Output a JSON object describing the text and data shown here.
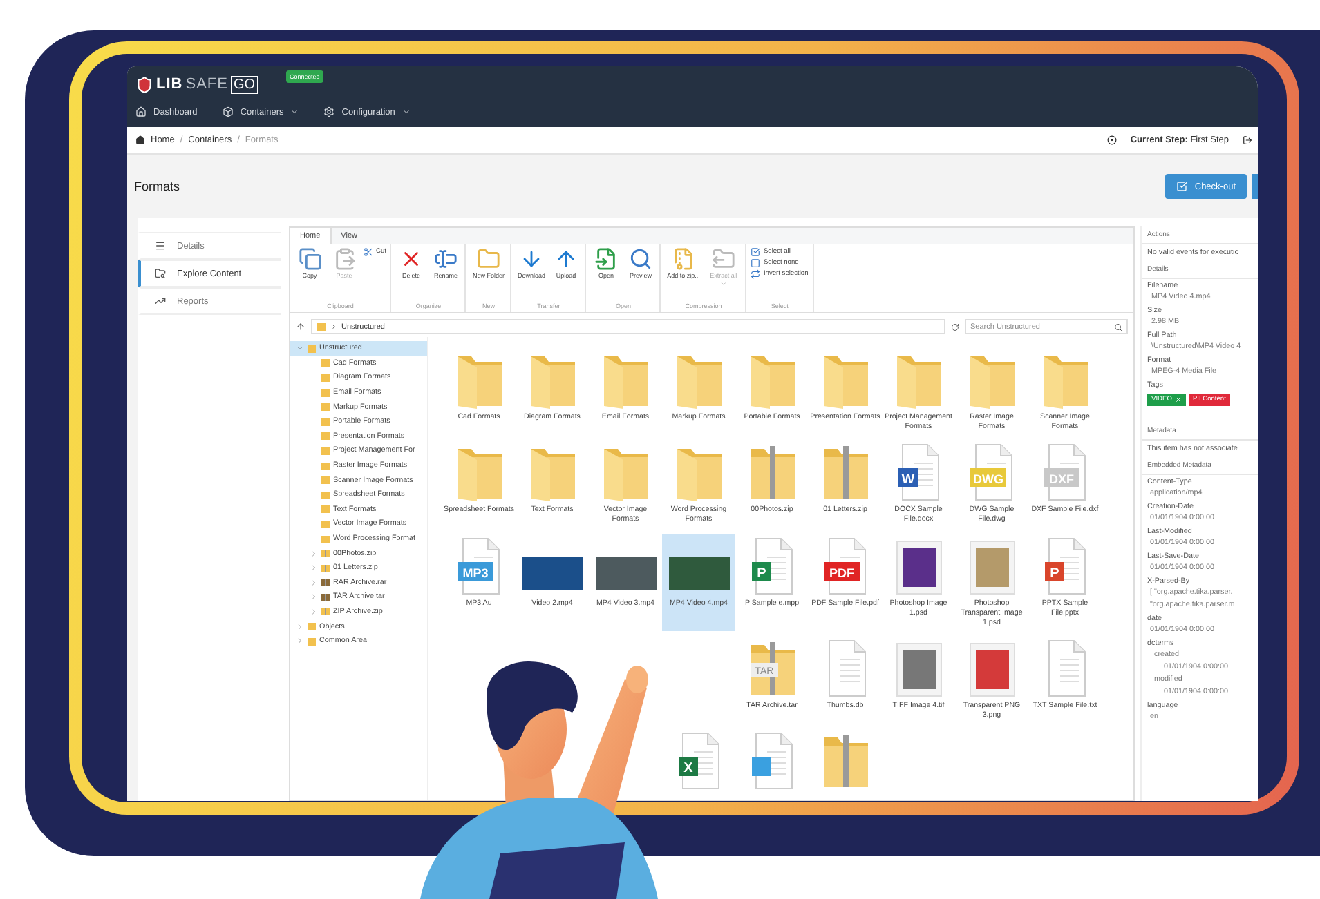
{
  "app": {
    "logo_left": "LIB",
    "logo_right": "SAFE",
    "logo_badge": "GO",
    "status": "Connected"
  },
  "nav": [
    {
      "label": "Dashboard",
      "dropdown": false
    },
    {
      "label": "Containers",
      "dropdown": true
    },
    {
      "label": "Configuration",
      "dropdown": true
    }
  ],
  "breadcrumb": [
    "Home",
    "Containers",
    "Formats"
  ],
  "breadcrumb_separator": "/",
  "current_step": {
    "label": "Current Step:",
    "value": "First Step"
  },
  "page_title": "Formats",
  "checkout_button": "Check-out",
  "side_menu": [
    {
      "label": "Details",
      "selected": false
    },
    {
      "label": "Explore Content",
      "selected": true
    },
    {
      "label": "Reports",
      "selected": false
    }
  ],
  "explorer": {
    "tabs": [
      {
        "label": "Home",
        "selected": true
      },
      {
        "label": "View",
        "selected": false
      }
    ],
    "ribbon_groups": [
      {
        "name": "Clipboard",
        "buttons": [
          {
            "label": "Copy",
            "kind": "large",
            "disabled": false
          },
          {
            "label": "Paste",
            "kind": "large",
            "disabled": true
          },
          {
            "label": "Cut",
            "kind": "small",
            "disabled": false
          }
        ]
      },
      {
        "name": "Organize",
        "buttons": [
          {
            "label": "Delete",
            "kind": "large",
            "disabled": false
          },
          {
            "label": "Rename",
            "kind": "large",
            "disabled": false
          }
        ]
      },
      {
        "name": "New",
        "buttons": [
          {
            "label": "New Folder",
            "kind": "large",
            "disabled": false
          }
        ]
      },
      {
        "name": "Transfer",
        "buttons": [
          {
            "label": "Download",
            "kind": "large",
            "disabled": false
          },
          {
            "label": "Upload",
            "kind": "large",
            "disabled": false
          }
        ]
      },
      {
        "name": "Open",
        "buttons": [
          {
            "label": "Open",
            "kind": "large",
            "disabled": false
          },
          {
            "label": "Preview",
            "kind": "large",
            "disabled": false
          }
        ]
      },
      {
        "name": "Compression",
        "buttons": [
          {
            "label": "Add to zip...",
            "kind": "large",
            "disabled": false
          },
          {
            "label": "Extract all",
            "kind": "large",
            "disabled": true,
            "dropdown": true
          }
        ]
      },
      {
        "name": "Select",
        "buttons": [
          {
            "label": "Select all",
            "kind": "small",
            "disabled": false
          },
          {
            "label": "Select none",
            "kind": "small",
            "disabled": false
          },
          {
            "label": "Invert selection",
            "kind": "small",
            "disabled": false
          }
        ]
      }
    ],
    "path": "Unstructured",
    "search_placeholder": "Search Unstructured",
    "tree": [
      {
        "label": "Unstructured",
        "kind": "folder",
        "expanded": true,
        "selected": true,
        "children": [
          {
            "label": "Cad Formats",
            "kind": "folder",
            "selected": false
          },
          {
            "label": "Diagram Formats",
            "kind": "folder",
            "selected": false
          },
          {
            "label": "Email Formats",
            "kind": "folder",
            "selected": false
          },
          {
            "label": "Markup Formats",
            "kind": "folder",
            "selected": false
          },
          {
            "label": "Portable Formats",
            "kind": "folder",
            "selected": false
          },
          {
            "label": "Presentation Formats",
            "kind": "folder",
            "selected": false
          },
          {
            "label": "Project Management For",
            "kind": "folder",
            "selected": false
          },
          {
            "label": "Raster Image Formats",
            "kind": "folder",
            "selected": false
          },
          {
            "label": "Scanner Image Formats",
            "kind": "folder",
            "selected": false
          },
          {
            "label": "Spreadsheet Formats",
            "kind": "folder",
            "selected": false
          },
          {
            "label": "Text Formats",
            "kind": "folder",
            "selected": false
          },
          {
            "label": "Vector Image Formats",
            "kind": "folder",
            "selected": false
          },
          {
            "label": "Word Processing Format",
            "kind": "folder",
            "selected": false
          },
          {
            "label": "00Photos.zip",
            "kind": "zip",
            "expanded": false,
            "selected": false
          },
          {
            "label": "01 Letters.zip",
            "kind": "zip",
            "expanded": false,
            "selected": false
          },
          {
            "label": "RAR Archive.rar",
            "kind": "archive",
            "expanded": false,
            "selected": false
          },
          {
            "label": "TAR Archive.tar",
            "kind": "archive",
            "expanded": false,
            "selected": false
          },
          {
            "label": "ZIP Archive.zip",
            "kind": "zip",
            "expanded": false,
            "selected": false
          }
        ]
      },
      {
        "label": "Objects",
        "kind": "folder",
        "expanded": false,
        "selected": false
      },
      {
        "label": "Common Area",
        "kind": "folder",
        "expanded": false,
        "selected": false
      }
    ],
    "items": [
      {
        "label": "Cad Formats",
        "kind": "folder",
        "selected": false
      },
      {
        "label": "Diagram Formats",
        "kind": "folder",
        "selected": false
      },
      {
        "label": "Email Formats",
        "kind": "folder",
        "selected": false
      },
      {
        "label": "Markup Formats",
        "kind": "folder",
        "selected": false
      },
      {
        "label": "Portable Formats",
        "kind": "folder",
        "selected": false
      },
      {
        "label": "Presentation Formats",
        "kind": "folder",
        "selected": false
      },
      {
        "label": "Project Management Formats",
        "kind": "folder",
        "selected": false
      },
      {
        "label": "Raster Image Formats",
        "kind": "folder",
        "selected": false
      },
      {
        "label": "Scanner Image Formats",
        "kind": "folder",
        "selected": false
      },
      {
        "label": "Spreadsheet Formats",
        "kind": "folder",
        "selected": false
      },
      {
        "label": "Text Formats",
        "kind": "folder",
        "selected": false
      },
      {
        "label": "Vector Image Formats",
        "kind": "folder",
        "selected": false
      },
      {
        "label": "Word Processing Formats",
        "kind": "folder",
        "selected": false
      },
      {
        "label": "00Photos.zip",
        "kind": "zip",
        "selected": false
      },
      {
        "label": "01 Letters.zip",
        "kind": "zip",
        "selected": false
      },
      {
        "label": "DOCX Sample File.docx",
        "kind": "document",
        "badge": "W",
        "color": "#2b5fb4",
        "selected": false
      },
      {
        "label": "DWG Sample File.dwg",
        "kind": "document",
        "badge": "DWG",
        "color": "#e8c93a",
        "selected": false
      },
      {
        "label": "DXF Sample File.dxf",
        "kind": "document",
        "badge": "DXF",
        "color": "#c8c8c8",
        "selected": false
      },
      {
        "label": "MP3 Au",
        "kind": "document",
        "badge": "MP3",
        "color": "#3a9ad9",
        "selected": false
      },
      {
        "label": "Video 2.mp4",
        "kind": "video",
        "color": "#1b4f8a",
        "selected": false
      },
      {
        "label": "MP4 Video 3.mp4",
        "kind": "video",
        "color": "#4d5a5e",
        "selected": false
      },
      {
        "label": "MP4 Video 4.mp4",
        "kind": "video",
        "color": "#2f5a3d",
        "selected": true
      },
      {
        "label": "P Sample e.mpp",
        "kind": "document",
        "badge": "P",
        "color": "#1d8a4c",
        "selected": false
      },
      {
        "label": "PDF Sample File.pdf",
        "kind": "document",
        "badge": "PDF",
        "color": "#e02424",
        "selected": false
      },
      {
        "label": "Photoshop Image 1.psd",
        "kind": "image",
        "color": "#5a2f8a",
        "selected": false
      },
      {
        "label": "Photoshop Transparent Image 1.psd",
        "kind": "image",
        "color": "#b49a6a",
        "selected": false
      },
      {
        "label": "PPTX Sample File.pptx",
        "kind": "document",
        "badge": "P",
        "color": "#d9452b",
        "selected": false
      },
      {
        "label": "TAR Archive.tar",
        "kind": "zip",
        "badge": "TAR",
        "selected": false
      },
      {
        "label": "Thumbs.db",
        "kind": "document",
        "selected": false
      },
      {
        "label": "TIFF Image 4.tif",
        "kind": "image",
        "color": "#777777",
        "selected": false
      },
      {
        "label": "Transparent PNG 3.png",
        "kind": "image",
        "color": "#d43a3a",
        "selected": false
      },
      {
        "label": "TXT Sample File.txt",
        "kind": "document",
        "selected": false
      },
      {
        "kind": "document",
        "badge": "X",
        "color": "#1d7a44",
        "selected": false
      },
      {
        "kind": "document",
        "color": "#3aa0e0",
        "selected": false
      },
      {
        "kind": "zip",
        "selected": false
      }
    ]
  },
  "details_panel": {
    "actions_title": "Actions",
    "actions_text": "No valid events for executio",
    "details_title": "Details",
    "fields": [
      {
        "label": "Filename",
        "value": "MP4 Video 4.mp4"
      },
      {
        "label": "Size",
        "value": "2.98 MB"
      },
      {
        "label": "Full Path",
        "value": "\\Unstructured\\MP4 Video 4"
      },
      {
        "label": "Format",
        "value": "MPEG-4 Media File"
      }
    ],
    "tags_label": "Tags",
    "tags": [
      {
        "label": "VIDEO",
        "removable": true,
        "color": "#1e9e4a"
      },
      {
        "label": "PII Content",
        "removable": false,
        "color": "#e0293a"
      }
    ],
    "metadata_title": "Metadata",
    "metadata_text": "This item has not associate",
    "embedded_title": "Embedded Metadata",
    "embedded": [
      {
        "label": "Content-Type",
        "values": [
          "application/mp4"
        ]
      },
      {
        "label": "Creation-Date",
        "values": [
          "01/01/1904 0:00:00"
        ]
      },
      {
        "label": "Last-Modified",
        "values": [
          "01/01/1904 0:00:00"
        ]
      },
      {
        "label": "Last-Save-Date",
        "values": [
          "01/01/1904 0:00:00"
        ]
      },
      {
        "label": "X-Parsed-By",
        "values": [
          "[ \"org.apache.tika.parser.",
          "\"org.apache.tika.parser.m"
        ]
      },
      {
        "label": "date",
        "values": [
          "01/01/1904 0:00:00"
        ]
      },
      {
        "label": "dcterms",
        "children": [
          {
            "label": "created",
            "values": [
              "01/01/1904 0:00:00"
            ]
          },
          {
            "label": "modified",
            "values": [
              "01/01/1904 0:00:00"
            ]
          }
        ]
      },
      {
        "label": "language",
        "values": [
          "en"
        ]
      }
    ]
  }
}
